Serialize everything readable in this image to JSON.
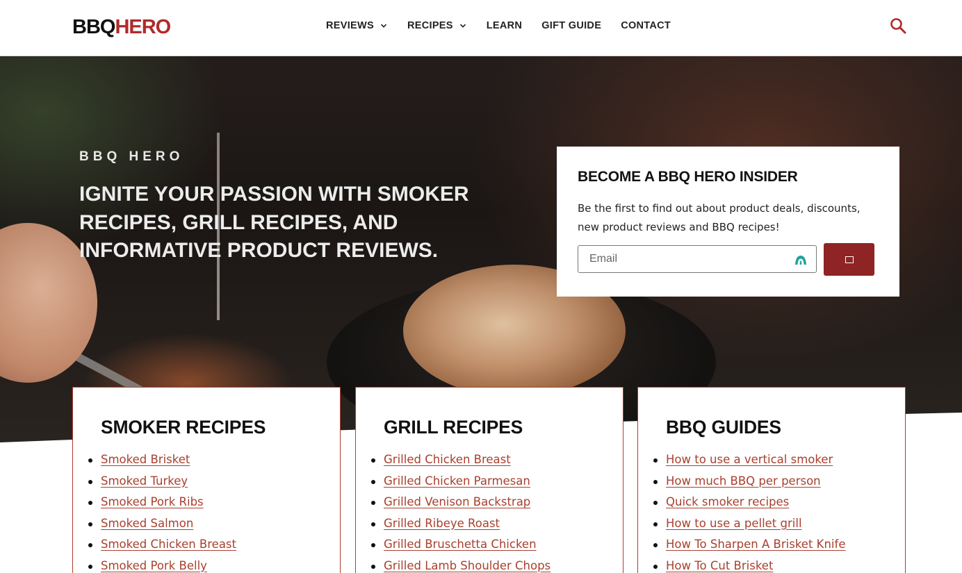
{
  "header": {
    "logo": {
      "part1": "BBQ",
      "part2": "HERO"
    },
    "nav": [
      {
        "label": "REVIEWS",
        "has_dropdown": true
      },
      {
        "label": "RECIPES",
        "has_dropdown": true
      },
      {
        "label": "LEARN",
        "has_dropdown": false
      },
      {
        "label": "GIFT GUIDE",
        "has_dropdown": false
      },
      {
        "label": "CONTACT",
        "has_dropdown": false
      }
    ],
    "search_icon": "search-icon"
  },
  "hero": {
    "kicker": "BBQ HERO",
    "title": "IGNITE YOUR PASSION WITH SMOKER RECIPES, GRILL RECIPES, AND INFORMATIVE PRODUCT REVIEWS."
  },
  "signup": {
    "title": "BECOME A BBQ HERO INSIDER",
    "description": "Be the first to find out about product deals, discounts, new product reviews and BBQ recipes!",
    "email_placeholder": "Email",
    "email_value": "",
    "submit_icon": "square-icon"
  },
  "cards": [
    {
      "title": "SMOKER RECIPES",
      "links": [
        "Smoked Brisket",
        "Smoked Turkey",
        "Smoked Pork Ribs",
        "Smoked Salmon",
        "Smoked Chicken Breast",
        "Smoked Pork Belly"
      ]
    },
    {
      "title": "GRILL RECIPES",
      "links": [
        "Grilled Chicken Breast",
        "Grilled Chicken Parmesan",
        "Grilled Venison Backstrap",
        "Grilled Ribeye Roast",
        "Grilled Bruschetta Chicken",
        "Grilled Lamb Shoulder Chops"
      ]
    },
    {
      "title": "BBQ GUIDES",
      "links": [
        "How to use a vertical smoker",
        "How much BBQ per person",
        "Quick smoker recipes",
        "How to use a pellet grill",
        "How To Sharpen A Brisket Knife",
        "How To Cut Brisket"
      ]
    }
  ],
  "colors": {
    "brand_red": "#b02a2a",
    "button_red": "#8f2424",
    "link_color": "#a8402e",
    "card_border": "#b13a2e"
  }
}
